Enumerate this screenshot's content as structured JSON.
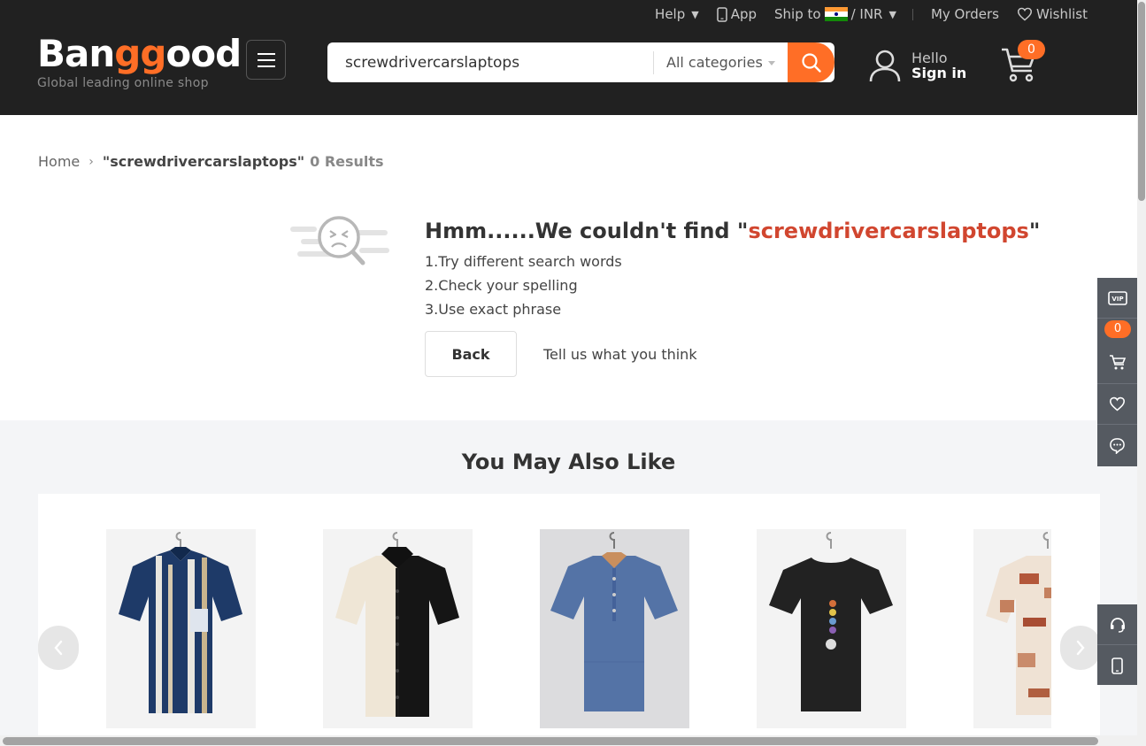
{
  "topbar": {
    "help": "Help",
    "app": "App",
    "ship_to": "Ship to",
    "currency": "/ INR",
    "orders": "My Orders",
    "wishlist": "Wishlist"
  },
  "logo": {
    "brand_a": "Ban",
    "brand_b": "gg",
    "brand_c": "ood",
    "tagline": "Global leading online shop"
  },
  "search": {
    "value": "screwdrivercarslaptops",
    "category": "All categories"
  },
  "account": {
    "hello": "Hello",
    "signin": "Sign in"
  },
  "cart": {
    "count": "0"
  },
  "breadcrumb": {
    "home": "Home",
    "query": "\"screwdrivercarslaptops\"",
    "results": "0 Results"
  },
  "no_results": {
    "prefix": "Hmm......We couldn't find \"",
    "keyword": "screwdrivercarslaptops",
    "suffix": "\"",
    "tips": [
      "1.Try different search words",
      "2.Check your spelling",
      "3.Use exact phrase"
    ],
    "back": "Back",
    "feedback": "Tell us what you think"
  },
  "recommendations": {
    "title": "You May Also Like",
    "products": [
      {
        "kind": "striped-navy-shirt"
      },
      {
        "kind": "black-cream-shirt"
      },
      {
        "kind": "denim-linen-shirt"
      },
      {
        "kind": "black-tshirt"
      },
      {
        "kind": "printed-shirt"
      }
    ]
  },
  "side_toolbar": {
    "cart_count": "0",
    "vip": "VIP"
  },
  "colors": {
    "accent": "#ff6e26",
    "header": "#212121",
    "keyword": "#d1462f",
    "sidebar": "#555a61"
  }
}
